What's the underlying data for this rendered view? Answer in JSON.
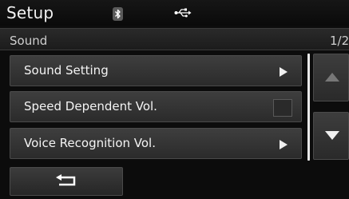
{
  "header": {
    "title": "Setup",
    "bluetooth_icon": "bluetooth-icon",
    "usb_icon": "usb-icon"
  },
  "subheader": {
    "title": "Sound",
    "page": "1/2"
  },
  "menu": {
    "items": [
      {
        "label": "Sound Setting",
        "control": "chevron-right-icon"
      },
      {
        "label": "Speed Dependent Vol.",
        "control": "checkbox",
        "checked": false
      },
      {
        "label": "Voice Recognition Vol.",
        "control": "chevron-right-icon"
      }
    ]
  },
  "scroll": {
    "up_icon": "triangle-up-icon",
    "down_icon": "triangle-down-icon"
  },
  "footer": {
    "back_icon": "back-arrow-icon"
  }
}
